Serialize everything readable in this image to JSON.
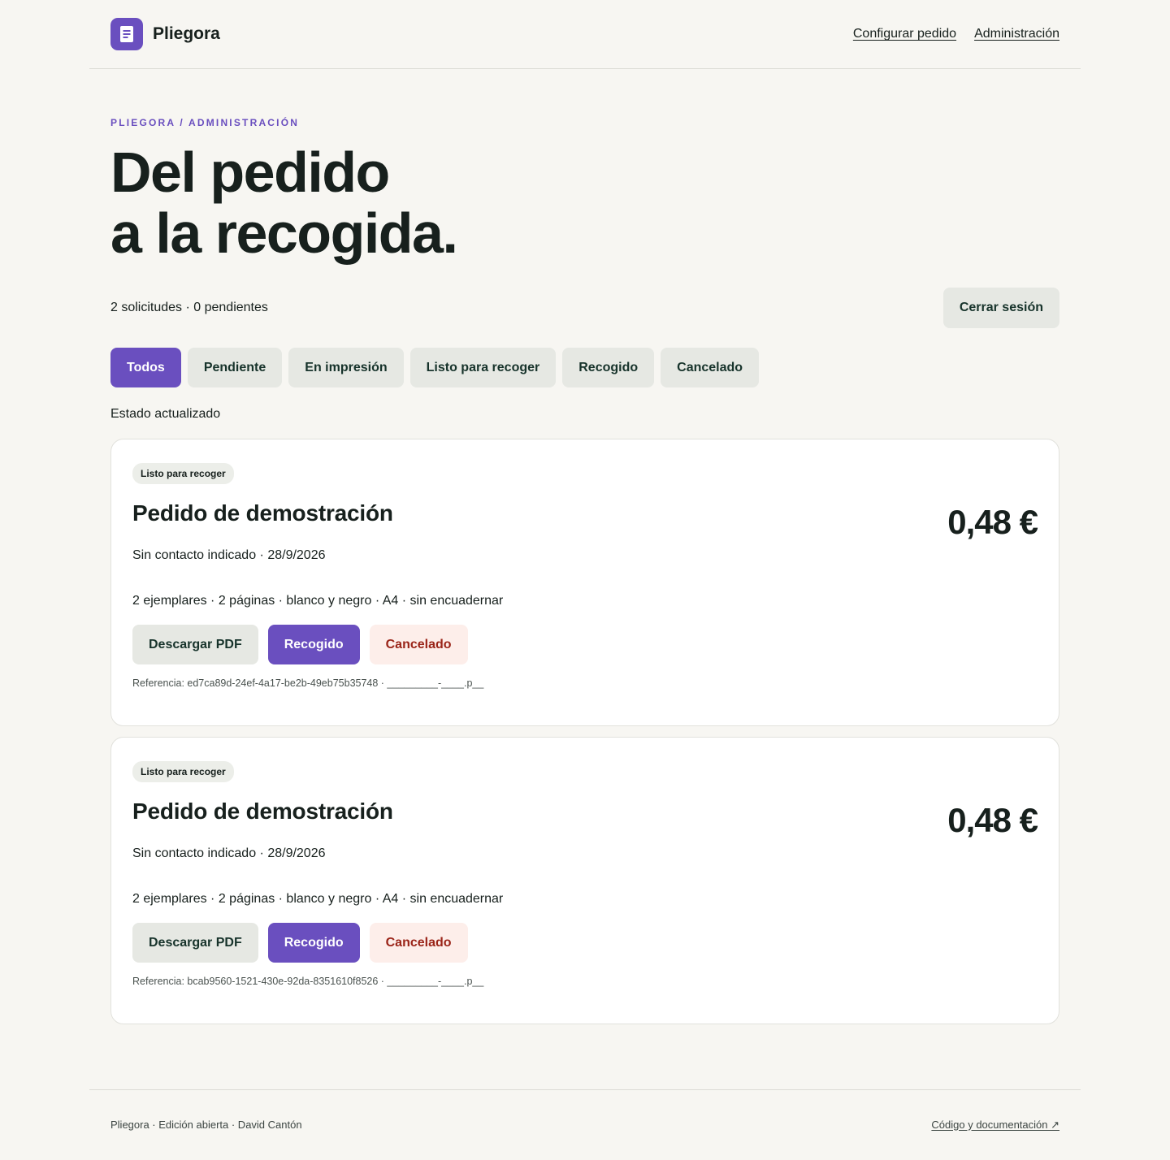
{
  "header": {
    "brand": "Pliegora",
    "logo_icon": "document-icon",
    "nav": [
      "Configurar pedido",
      "Administración"
    ]
  },
  "hero": {
    "eyebrow": "PLIEGORA / ADMINISTRACIÓN",
    "title_line1": "Del pedido",
    "title_line2": "a la recogida."
  },
  "summary": "2 solicitudes · 0 pendientes",
  "logout_label": "Cerrar sesión",
  "filters": [
    "Todos",
    "Pendiente",
    "En impresión",
    "Listo para recoger",
    "Recogido",
    "Cancelado"
  ],
  "active_filter": "Todos",
  "status_message": "Estado actualizado",
  "orders": [
    {
      "status": "Listo para recoger",
      "title": "Pedido de demostración",
      "price": "0,48 €",
      "contact": "Sin contacto indicado · 28/9/2026",
      "specs": "2 ejemplares · 2 páginas · blanco y negro · A4 · sin encuadernar",
      "actions": {
        "download": "Descargar PDF",
        "collected": "Recogido",
        "cancelled": "Cancelado"
      },
      "reference": "Referencia: ed7ca89d-24ef-4a17-be2b-49eb75b35748 · _________-____.p__"
    },
    {
      "status": "Listo para recoger",
      "title": "Pedido de demostración",
      "price": "0,48 €",
      "contact": "Sin contacto indicado · 28/9/2026",
      "specs": "2 ejemplares · 2 páginas · blanco y negro · A4 · sin encuadernar",
      "actions": {
        "download": "Descargar PDF",
        "collected": "Recogido",
        "cancelled": "Cancelado"
      },
      "reference": "Referencia: bcab9560-1521-430e-92da-8351610f8526 · _________-____.p__"
    }
  ],
  "footer": {
    "text": "Pliegora · Edición abierta · David Cantón",
    "link": "Código y documentación ↗"
  },
  "colors": {
    "accent": "#6a4fbf",
    "background": "#f7f6f2",
    "danger_text": "#9a2418",
    "danger_bg": "#fdeeea",
    "neutral_button": "#e6e8e3"
  }
}
